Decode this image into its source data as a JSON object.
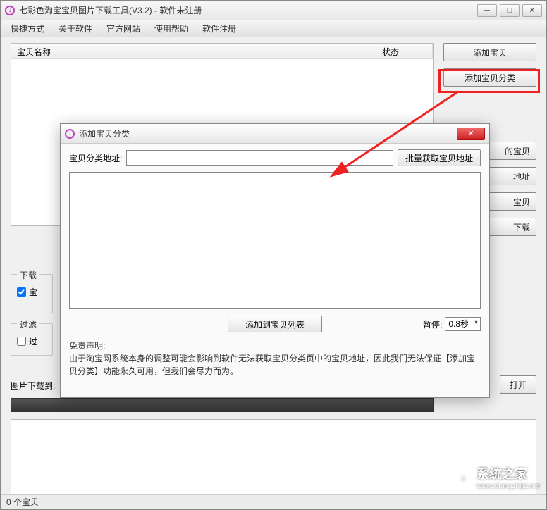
{
  "window": {
    "title": "七彩色淘宝宝贝图片下载工具(V3.2) - 软件未注册",
    "controls": {
      "min": "─",
      "max": "□",
      "close": "✕"
    }
  },
  "menu": [
    "快捷方式",
    "关于软件",
    "官方网站",
    "使用帮助",
    "软件注册"
  ],
  "list": {
    "col_name": "宝贝名称",
    "col_status": "状态"
  },
  "sideButtons": {
    "add": "添加宝贝",
    "addCategory": "添加宝贝分类",
    "partial3": "的宝贝",
    "partial4": "地址",
    "partial5": "宝贝",
    "partial6": "下载"
  },
  "groups": {
    "download": "下载",
    "downloadChk": "宝",
    "filter": "过滤",
    "filterChk": "过"
  },
  "downloadTo": "图片下载到:",
  "openBtn": "打开",
  "statusbar": "0 个宝贝",
  "dialog": {
    "title": "添加宝贝分类",
    "fieldLabel": "宝贝分类地址:",
    "inputValue": "",
    "fetchBtn": "批量获取宝贝地址",
    "addToListBtn": "添加到宝贝列表",
    "pauseLabel": "暂停:",
    "pauseValue": "0.8秒",
    "disclaimerTitle": "免责声明:",
    "disclaimerBody": "由于淘宝网系统本身的调整可能会影响到软件无法获取宝贝分类页中的宝贝地址，因此我们无法保证【添加宝贝分类】功能永久可用，但我们会尽力而为。"
  },
  "watermark": {
    "brand": "系统之家",
    "url": "www.xitongzhijia.net"
  }
}
